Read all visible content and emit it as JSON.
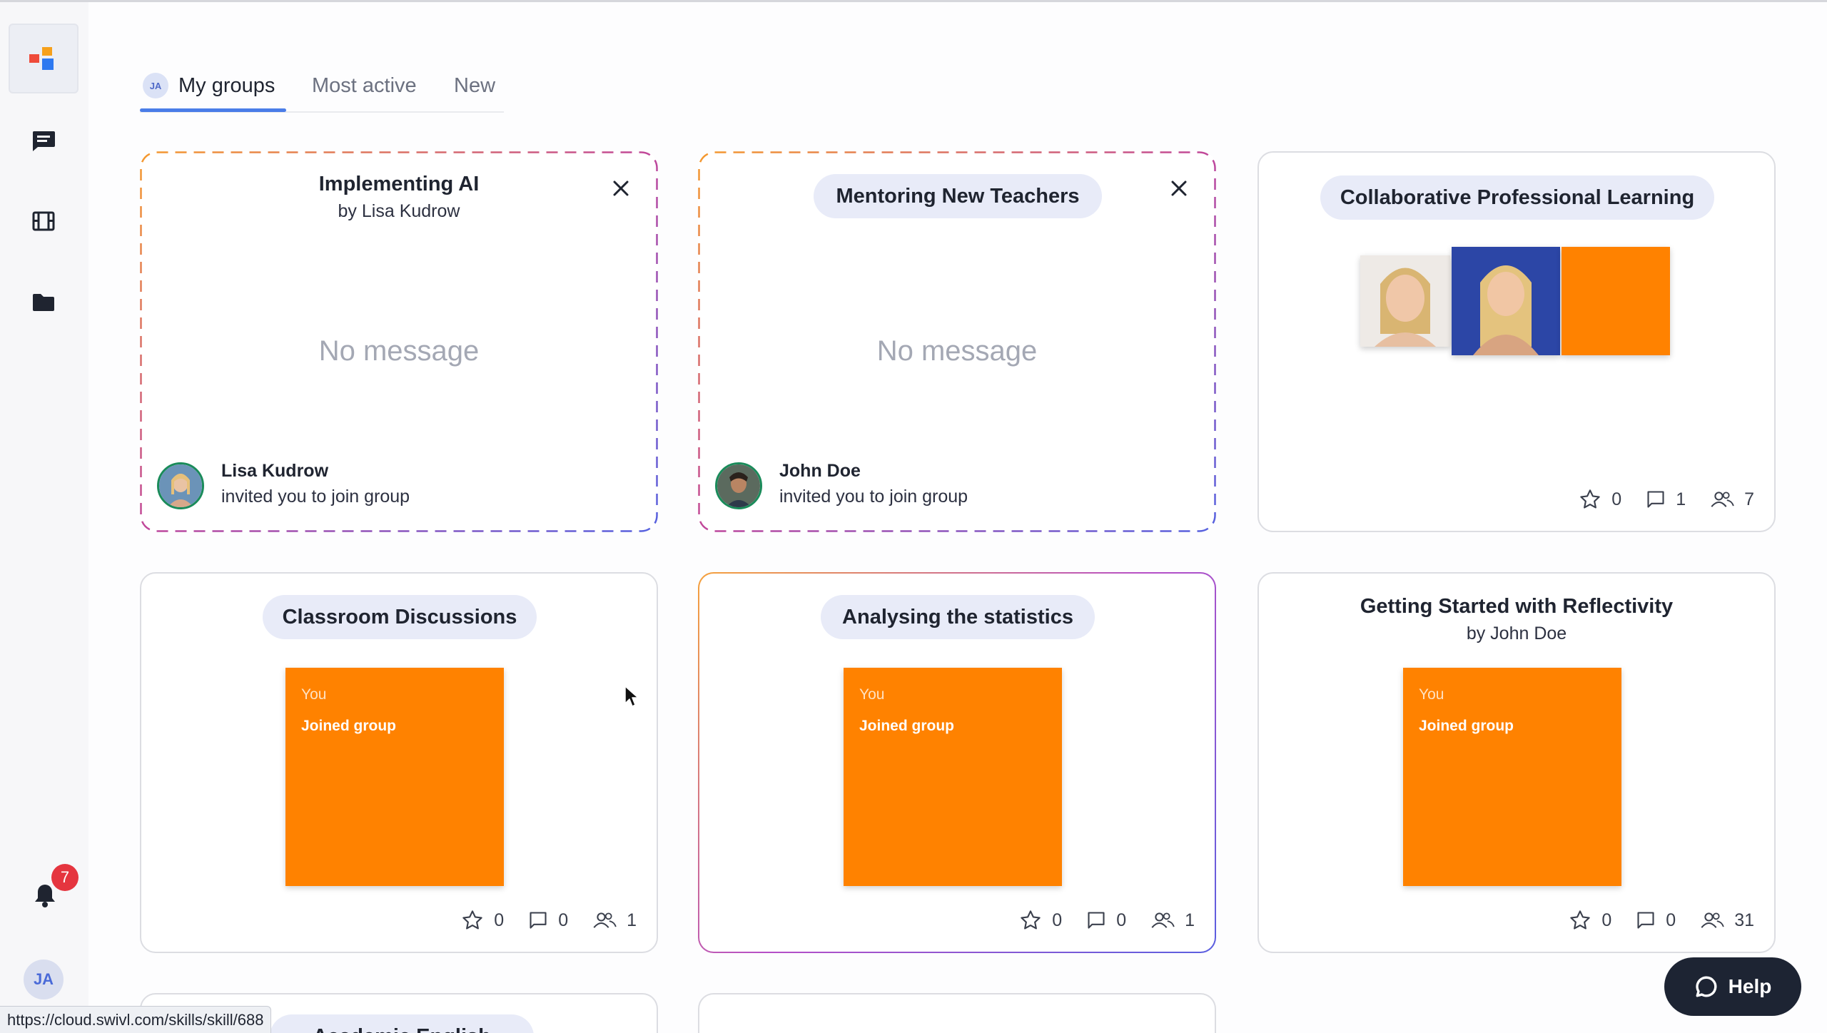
{
  "sidebar": {
    "notification_count": "7",
    "user_initials": "JA"
  },
  "tabs": [
    {
      "label": "My groups",
      "avatar": "JA",
      "active": true
    },
    {
      "label": "Most active",
      "active": false
    },
    {
      "label": "New",
      "active": false
    }
  ],
  "cards": [
    {
      "title": "Implementing AI",
      "subtitle": "by Lisa Kudrow",
      "message": "No message",
      "inviter": "Lisa Kudrow",
      "invite_text": "invited you to join group"
    },
    {
      "title": "Mentoring New Teachers",
      "message": "No message",
      "inviter": "John Doe",
      "invite_text": "invited you to join group"
    },
    {
      "title": "Collaborative Professional Learning",
      "stats": {
        "stars": "0",
        "comments": "1",
        "members": "7"
      }
    },
    {
      "title": "Classroom Discussions",
      "tile": {
        "you": "You",
        "joined": "Joined group"
      },
      "stats": {
        "stars": "0",
        "comments": "0",
        "members": "1"
      }
    },
    {
      "title": "Analysing the statistics",
      "tile": {
        "you": "You",
        "joined": "Joined group"
      },
      "stats": {
        "stars": "0",
        "comments": "0",
        "members": "1"
      }
    },
    {
      "title": "Getting Started with Reflectivity",
      "subtitle": "by John Doe",
      "tile": {
        "you": "You",
        "joined": "Joined group"
      },
      "stats": {
        "stars": "0",
        "comments": "0",
        "members": "31"
      }
    },
    {
      "title": "Academic English"
    }
  ],
  "help_label": "Help",
  "status_url": "https://cloud.swivl.com/skills/skill/688",
  "colors": {
    "accent": "#4a7de8",
    "tile_orange": "#ff8200",
    "badge_red": "#e5353f",
    "help_bg": "#1d2433"
  }
}
